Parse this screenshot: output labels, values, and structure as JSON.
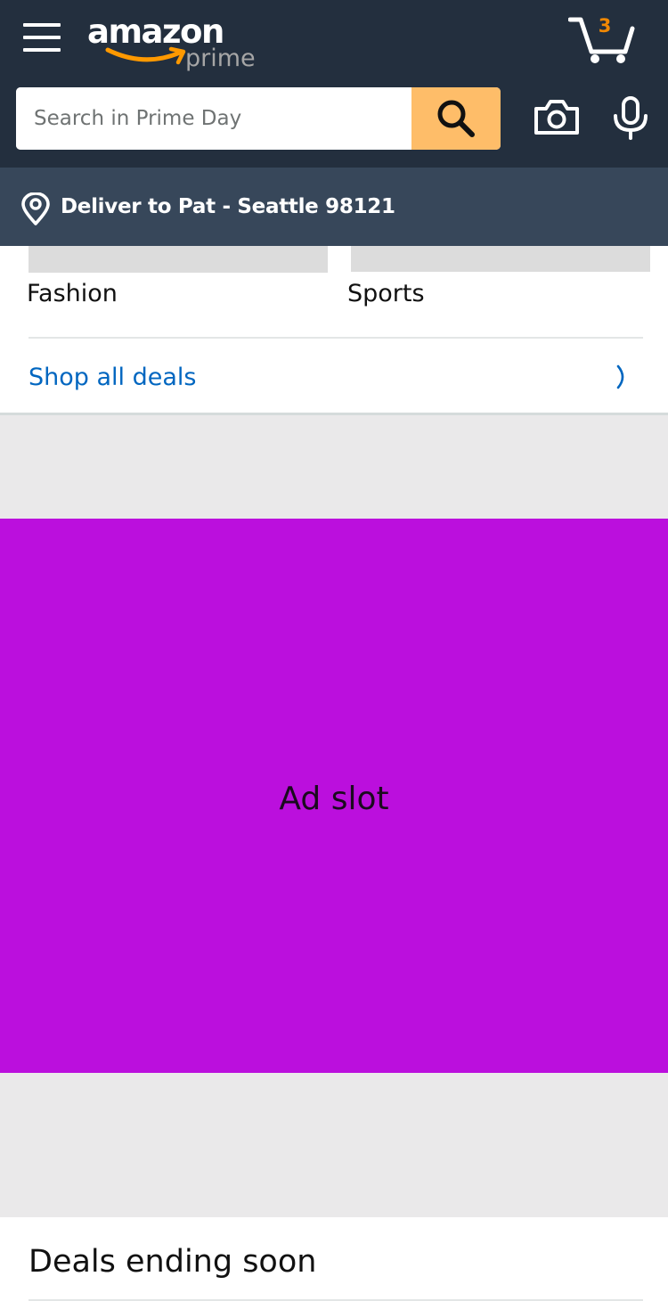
{
  "header": {
    "logo_text": "amazon",
    "logo_sub": "prime",
    "cart_count": "3",
    "search_placeholder": "Search in Prime Day",
    "icons": {
      "menu": "hamburger-menu-icon",
      "cart": "cart-icon",
      "search": "search-icon",
      "camera": "camera-icon",
      "microphone": "microphone-icon",
      "location": "location-pin-icon"
    }
  },
  "delivery": {
    "text": "Deliver to Pat - Seattle 98121"
  },
  "categories": {
    "tiles": [
      {
        "label": "Fashion"
      },
      {
        "label": "Sports"
      }
    ],
    "shop_all_label": "Shop all deals"
  },
  "ad": {
    "label": "Ad slot"
  },
  "deals_ending": {
    "title": "Deals ending soon"
  },
  "colors": {
    "header_bg": "#232f3e",
    "deliver_bg": "#37475a",
    "search_button": "#febd69",
    "link": "#0066c0",
    "cart_count": "#f08804",
    "ad_bg": "#bb0fdd",
    "page_bg": "#eae9ea"
  }
}
